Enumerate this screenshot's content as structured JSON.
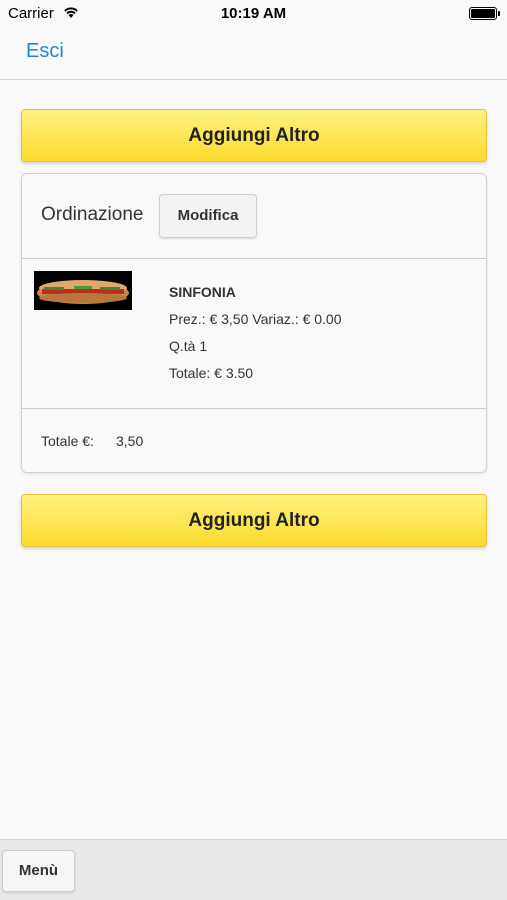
{
  "status_bar": {
    "carrier": "Carrier",
    "time": "10:19 AM",
    "wifi_icon": "wifi-icon",
    "battery_icon": "battery-icon"
  },
  "nav": {
    "back_label": "Esci"
  },
  "actions": {
    "add_more_label": "Aggiungi Altro"
  },
  "order": {
    "title": "Ordinazione",
    "edit_label": "Modifica",
    "items": [
      {
        "image": "sandwich-thumbnail",
        "name": "SINFONIA",
        "price_line": "Prez.: € 3,50 Variaz.: € 0.00",
        "qty_line": "Q.tà 1",
        "total_line": "Totale: € 3.50"
      }
    ],
    "total_label": "Totale €:",
    "total_value": "3,50"
  },
  "bottom_bar": {
    "menu_label": "Menù"
  },
  "colors": {
    "accent": "#1a86e0",
    "button_yellow_top": "#fff281",
    "button_yellow_bottom": "#fcd92d"
  }
}
